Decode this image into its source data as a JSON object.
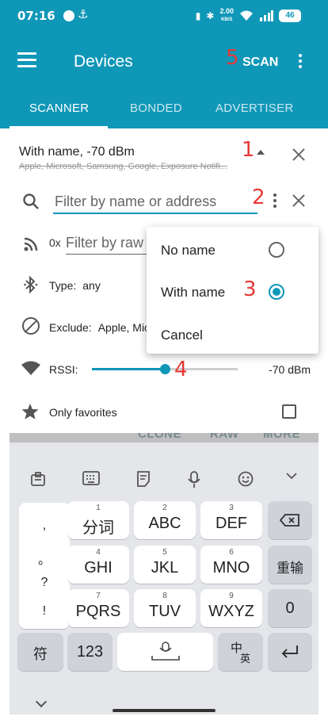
{
  "status_bar": {
    "time": "07:16",
    "net_speed_value": "2.00",
    "net_speed_unit": "KB/S",
    "battery": "46"
  },
  "app_bar": {
    "title": "Devices",
    "scan_label": "SCAN"
  },
  "tabs": [
    {
      "label": "SCANNER",
      "active": true
    },
    {
      "label": "BONDED",
      "active": false
    },
    {
      "label": "ADVERTISER",
      "active": false
    }
  ],
  "annotations": [
    "1",
    "2",
    "3",
    "4",
    "5"
  ],
  "filter": {
    "summary": "With name, -70 dBm",
    "summary_sub": "Apple, Microsoft, Samsung, Google, Exposure Notifi...",
    "search_placeholder": "Filter by name or address",
    "adv_prefix": "0x",
    "adv_placeholder": "Filter by raw advertising data",
    "type_label": "Type:",
    "type_value": "any",
    "exclude_label": "Exclude:",
    "exclude_value": "Apple, Microsoft, Samsung, Google",
    "rssi_label": "RSSI:",
    "rssi_value": "-70 dBm",
    "rssi_fraction": 0.5,
    "favorites_label": "Only favorites",
    "favorites_checked": false
  },
  "popup_menu": {
    "items": [
      {
        "label": "No name",
        "selected": false
      },
      {
        "label": "With name",
        "selected": true
      },
      {
        "label": "Cancel"
      }
    ]
  },
  "dimmed_actions": [
    "CLONE",
    "RAW",
    "MORE"
  ],
  "keyboard": {
    "symbols": [
      ",",
      "。",
      "?",
      "!"
    ],
    "rows": [
      [
        {
          "num": "1",
          "label": "分词"
        },
        {
          "num": "2",
          "label": "ABC"
        },
        {
          "num": "3",
          "label": "DEF"
        }
      ],
      [
        {
          "num": "4",
          "label": "GHI"
        },
        {
          "num": "5",
          "label": "JKL"
        },
        {
          "num": "6",
          "label": "MNO"
        }
      ],
      [
        {
          "num": "7",
          "label": "PQRS"
        },
        {
          "num": "8",
          "label": "TUV"
        },
        {
          "num": "9",
          "label": "WXYZ"
        }
      ]
    ],
    "side_keys": {
      "retype": "重输",
      "zero": "0"
    },
    "bottom": {
      "symbol": "符",
      "numbers": "123",
      "lang_top": "中",
      "lang_bottom": "英"
    }
  },
  "colors": {
    "primary": "#0f97b8",
    "annotation": "#e53935",
    "keyboard_bg": "#e4e6ea"
  }
}
